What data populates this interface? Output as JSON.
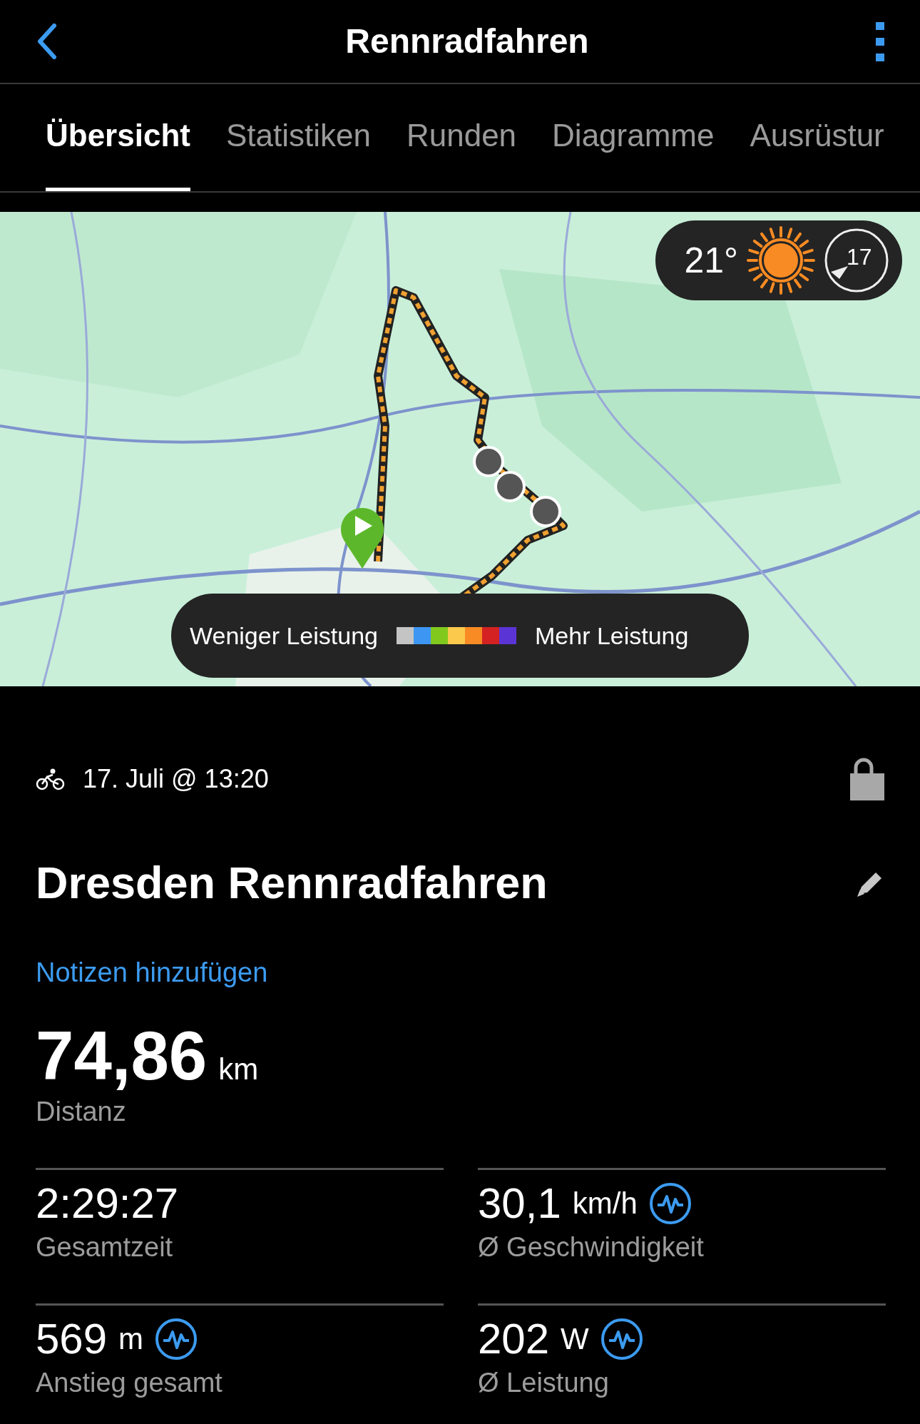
{
  "header": {
    "title": "Rennradfahren"
  },
  "tabs": [
    {
      "label": "Übersicht",
      "selected": true
    },
    {
      "label": "Statistiken",
      "selected": false
    },
    {
      "label": "Runden",
      "selected": false
    },
    {
      "label": "Diagramme",
      "selected": false
    },
    {
      "label": "Ausrüstur",
      "selected": false
    }
  ],
  "map": {
    "kind": "picture",
    "weather": {
      "temperature": "21°",
      "wind": "17"
    },
    "legend": {
      "low_label": "Weniger Leistung",
      "high_label": "Mehr Leistung",
      "colors": [
        {
          "color": "#c4c4c4"
        },
        {
          "color": "#3d97f2"
        },
        {
          "color": "#82c91e"
        },
        {
          "color": "#fbc94c"
        },
        {
          "color": "#f88b23"
        },
        {
          "color": "#d42222"
        },
        {
          "color": "#5b34d6"
        }
      ]
    }
  },
  "activity": {
    "date": "17. Juli @ 13:20",
    "title": "Dresden Rennradfahren",
    "notes_link": "Notizen hinzufügen",
    "distance": {
      "value": "74,86",
      "unit": "km",
      "label": "Distanz"
    }
  },
  "stats": [
    {
      "value": "2:29:27",
      "label": "Gesamtzeit",
      "insight": false
    },
    {
      "value": "30,1",
      "unit": "km/h",
      "label": "Ø Geschwindigkeit",
      "insight": true
    },
    {
      "value": "569",
      "unit": "m",
      "label": "Anstieg gesamt",
      "insight": true
    },
    {
      "value": "202",
      "unit": "W",
      "label": "Ø Leistung",
      "insight": true
    }
  ]
}
